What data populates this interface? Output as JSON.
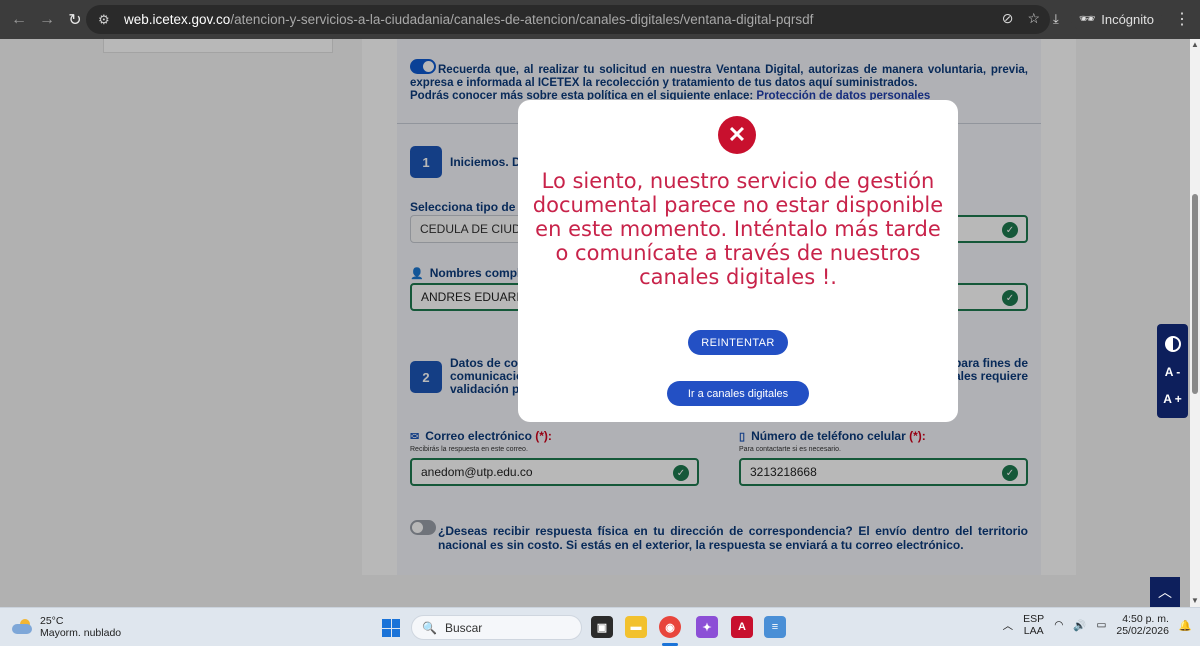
{
  "browser": {
    "url_host": "web.icetex.gov.co",
    "url_path": "/atencion-y-servicios-a-la-ciudadania/canales-de-atencion/canales-digitales/ventana-digital-pqrsdf",
    "incognito_label": "Incógnito"
  },
  "form": {
    "consent_text": "Recuerda que, al realizar tu solicitud en nuestra Ventana Digital, autorizas de manera voluntaria, previa, expresa e informada al ICETEX la recolección y tratamiento de tus datos aquí suministrados.",
    "consent_text2": "Podrás conocer más sobre esta política en el siguiente enlace: ",
    "consent_link": "Protección de datos personales",
    "step1_number": "1",
    "step1_title": "Iniciemos. Di",
    "id_type_label": "Selecciona tipo de i",
    "id_type_value": "CEDULA DE CIUDA",
    "names_label": "Nombres compl",
    "names_value": "ANDRES EDUARI",
    "step2_number": "2",
    "step2_text_left": "Datos de cor\ncomunicació\nvalidación pr",
    "step2_text_right": "para fines de\nales requiere",
    "email_label": "Correo electrónico",
    "email_required": "(*):",
    "email_hint": "Recibirás la respuesta en este correo.",
    "email_value": "anedom@utp.edu.co",
    "phone_label": "Número de teléfono celular",
    "phone_required": "(*):",
    "phone_hint": "Para contactarte si es necesario.",
    "phone_value": "3213218668",
    "physical_text": "¿Deseas recibir respuesta física en tu dirección de correspondencia? El envío dentro del territorio nacional es sin costo. Si estás en el exterior, la respuesta se enviará a tu correo electrónico."
  },
  "modal": {
    "close_symbol": "✕",
    "message": "Lo siento, nuestro servicio de gestión documental parece no estar disponible en este momento. Inténtalo más tarde o comunícate a través de nuestros canales digitales !.",
    "retry_label": "REINTENTAR",
    "channels_label": "Ir a canales digitales",
    "accent_color": "#c8234a",
    "button_color": "#2350c4"
  },
  "a11y": {
    "decrease_label": "A -",
    "increase_label": "A +"
  },
  "taskbar": {
    "temperature": "25°C",
    "weather": "Mayorm. nublado",
    "search_placeholder": "Buscar",
    "lang_top": "ESP",
    "lang_bottom": "LAA",
    "time": "4:50 p. m.",
    "date": "25/02/2026"
  }
}
